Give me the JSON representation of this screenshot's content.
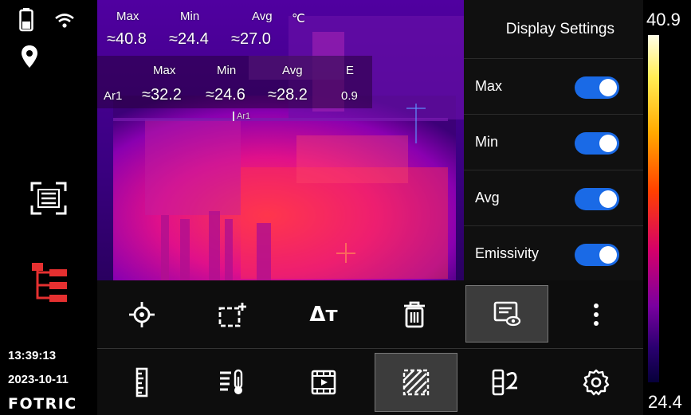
{
  "status": {
    "time": "13:39:13",
    "date": "2023-10-11",
    "brand": "FOTRIC",
    "icons": [
      "battery-icon",
      "wifi-icon",
      "location-icon",
      "scan-icon",
      "tree-structure-icon"
    ]
  },
  "global_readout": {
    "headers": {
      "max": "Max",
      "min": "Min",
      "avg": "Avg",
      "unit": "℃"
    },
    "values": {
      "max": "≈40.8",
      "min": "≈24.4",
      "avg": "≈27.0"
    }
  },
  "area_readout": {
    "headers": {
      "max": "Max",
      "min": "Min",
      "avg": "Avg",
      "emissivity": "E"
    },
    "label": "Ar1",
    "values": {
      "max": "≈32.2",
      "min": "≈24.6",
      "avg": "≈28.2",
      "emissivity": "0.9"
    },
    "region_tag": "Ar1"
  },
  "display_settings": {
    "title": "Display Settings",
    "items": [
      {
        "label": "Max",
        "enabled": true
      },
      {
        "label": "Min",
        "enabled": true
      },
      {
        "label": "Avg",
        "enabled": true
      },
      {
        "label": "Emissivity",
        "enabled": true
      }
    ]
  },
  "color_scale": {
    "max": "40.9",
    "min": "24.4",
    "palette": [
      "#ffffe8",
      "#ffaa00",
      "#ff4000",
      "#d4006a",
      "#7a00a0",
      "#06003a"
    ]
  },
  "toolbar_top": {
    "buttons": [
      "spot-measure-icon",
      "add-area-icon",
      "delta-t-icon",
      "delete-icon",
      "display-settings-icon",
      "more-icon"
    ],
    "selected": "display-settings-icon",
    "delta_label": "Δт"
  },
  "toolbar_bottom": {
    "buttons": [
      "ruler-icon",
      "thermometer-list-icon",
      "video-playback-icon",
      "hatch-area-icon",
      "palette-icon",
      "settings-gear-icon"
    ],
    "selected": "hatch-area-icon"
  },
  "colors": {
    "accent_toggle": "#1a6ae6",
    "alert_red": "#e53030"
  }
}
